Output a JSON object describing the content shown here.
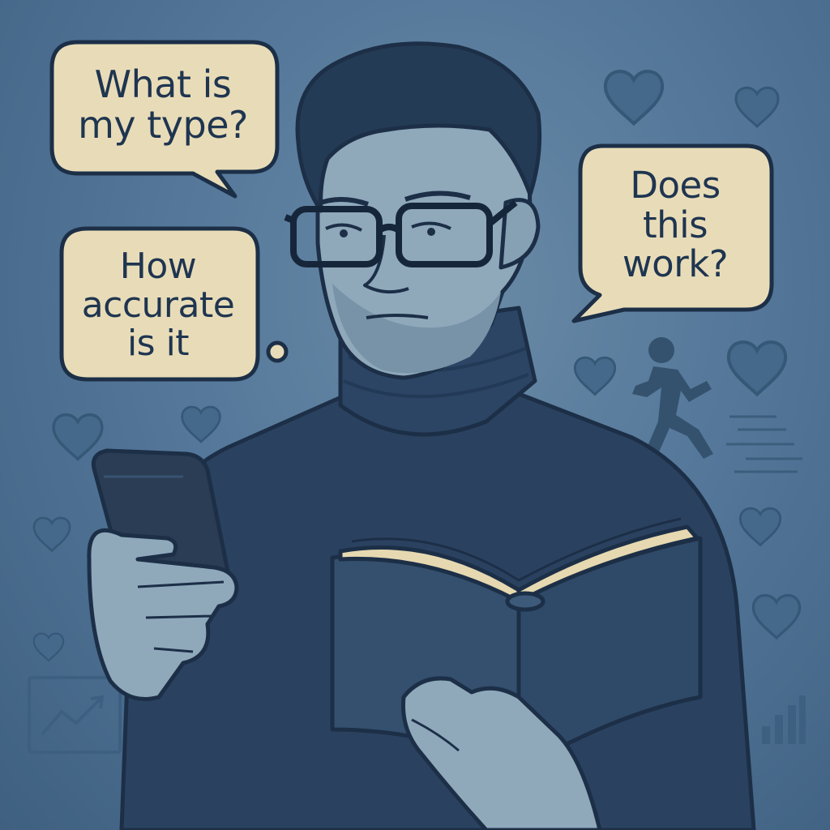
{
  "bubbles": {
    "top_left": "What is\nmy type?",
    "mid_left": "How\naccurate\nis it",
    "right": "Does\nthis\nwork?"
  },
  "colors": {
    "background": "#54779a",
    "bubble_fill": "#e8dcb8",
    "outline": "#1c2f47",
    "sweater": "#2a4260",
    "skin": "#8fa9bb",
    "heart": "#3f6585"
  },
  "icons": [
    "heart-icon",
    "running-person-icon",
    "trend-chart-icon",
    "bar-chart-icon",
    "phone",
    "open-book"
  ]
}
